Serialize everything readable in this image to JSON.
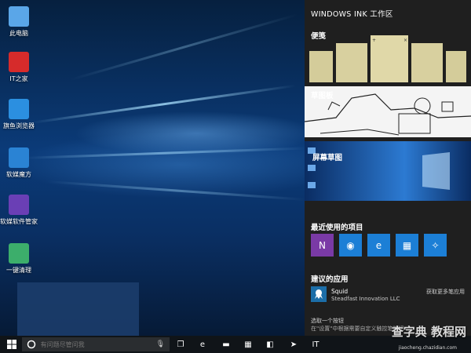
{
  "desktop": {
    "icons": [
      {
        "label": "此电脑",
        "icon": "pc-icon",
        "color": "#5aa6e8"
      },
      {
        "label": "IT之家",
        "icon": "ithome-icon",
        "color": "#d62b2b"
      },
      {
        "label": "旗鱼浏览器",
        "icon": "swordfish-browser-icon",
        "color": "#2b8fe0"
      },
      {
        "label": "软媒魔方",
        "icon": "ruanmei-cube-icon",
        "color": "#2a83d4"
      },
      {
        "label": "软媒软件管家",
        "icon": "ruanmei-software-manager-icon",
        "color": "#6a3fb5"
      },
      {
        "label": "一键清理",
        "icon": "one-click-clean-icon",
        "color": "#3cae6b"
      }
    ]
  },
  "ink_workspace": {
    "title": "WINDOWS INK 工作区",
    "sticky_label": "便笺",
    "sketch_label": "草图板",
    "screen_sketch_label": "屏幕草图",
    "recent_label": "最近使用的项目",
    "recent_apps": [
      {
        "name": "onenote-icon",
        "color": "#7a3aa6",
        "glyph": "N"
      },
      {
        "name": "camera-app-icon",
        "color": "#1c7fd6",
        "glyph": "◉"
      },
      {
        "name": "edge-icon",
        "color": "#1c7fd6",
        "glyph": "e"
      },
      {
        "name": "photos-icon",
        "color": "#1c7fd6",
        "glyph": "▦"
      },
      {
        "name": "tips-icon",
        "color": "#1c7fd6",
        "glyph": "✧"
      }
    ],
    "suggested_label": "建议的应用",
    "suggested_app_name": "Squid",
    "suggested_app_publisher": "Steadfast Innovation LLC",
    "suggested_more_label": "获取更多笔应用",
    "shortcut_line1": "选取一个按钮",
    "shortcut_line2": "在\"设置\"中根据需要自定义触控笔按钮"
  },
  "taskbar": {
    "search_placeholder": "有问题尽管问我",
    "pinned": [
      {
        "name": "task-view-icon",
        "glyph": "❐"
      },
      {
        "name": "edge-taskbar-icon",
        "glyph": "e"
      },
      {
        "name": "file-explorer-icon",
        "glyph": "▬"
      },
      {
        "name": "store-icon",
        "glyph": "▦"
      },
      {
        "name": "ruanmei-cube-taskbar-icon",
        "glyph": "◧"
      },
      {
        "name": "swordfish-taskbar-icon",
        "glyph": "➤"
      },
      {
        "name": "ithome-taskbar-icon",
        "glyph": "IT"
      }
    ]
  },
  "watermark": {
    "text": "查字典 教程网",
    "sub": "jiaocheng.chazidian.com"
  }
}
